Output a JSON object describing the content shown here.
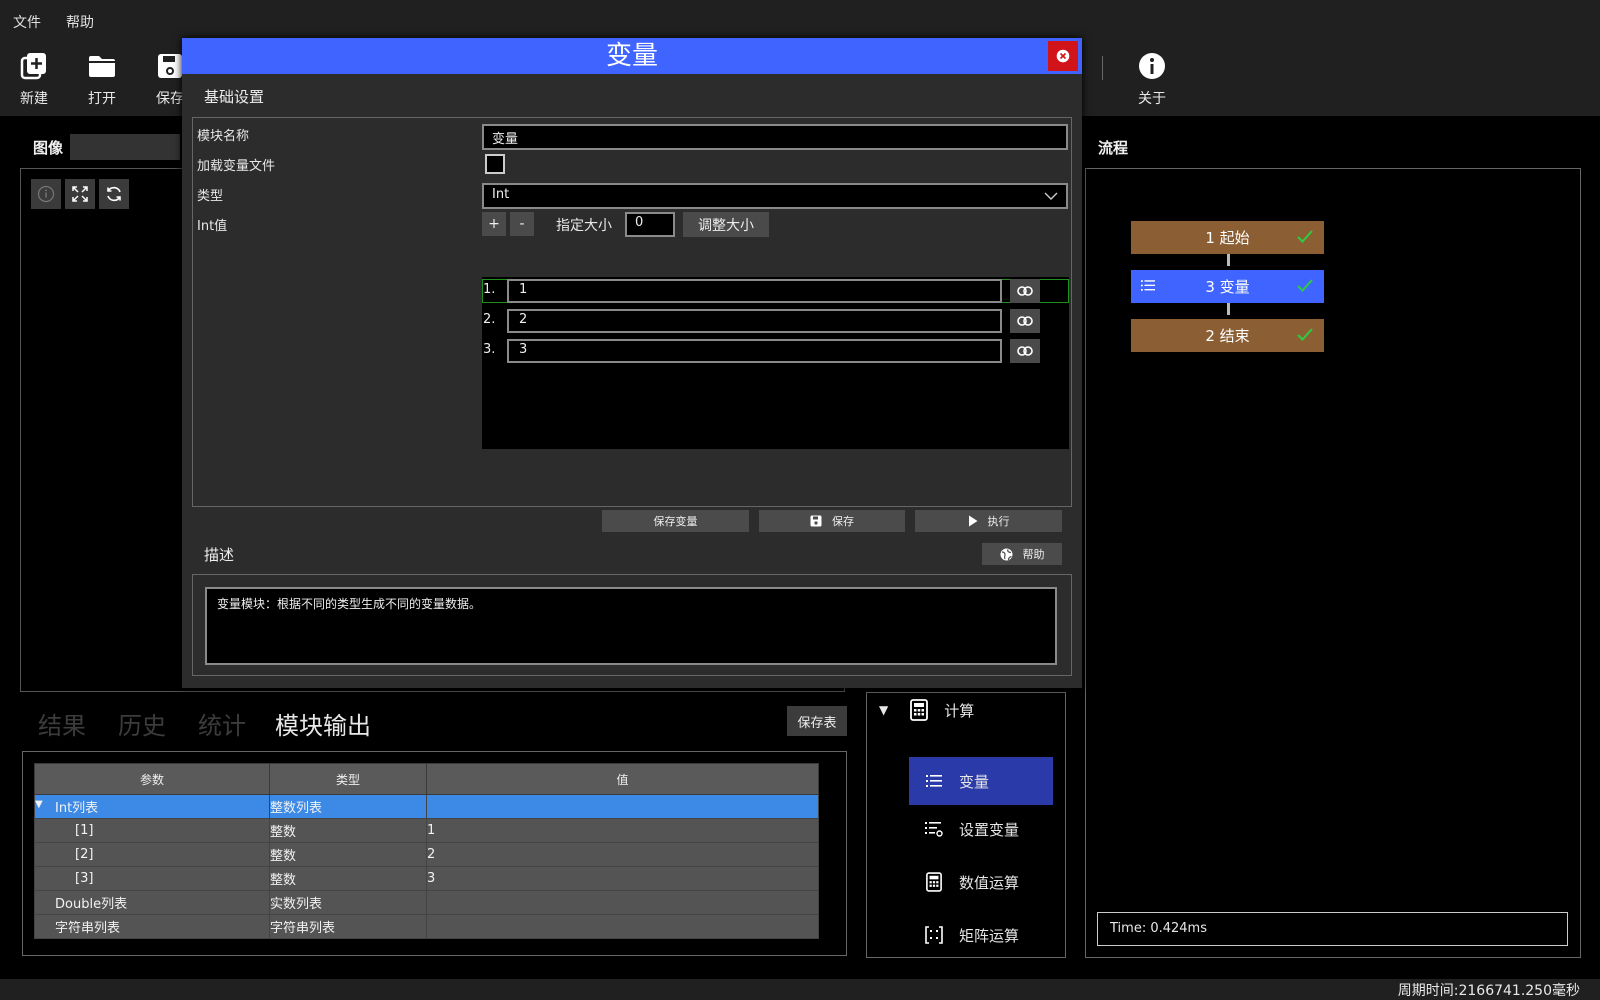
{
  "menu": [
    "文件",
    "帮助"
  ],
  "toolbar": {
    "new": "新建",
    "open": "打开",
    "save": "保存",
    "about": "关于"
  },
  "image_panel": {
    "title": "图像"
  },
  "flow_panel": {
    "title": "流程",
    "nodes": [
      {
        "label": "1 起始",
        "color": "#8b5e34",
        "status": "ok"
      },
      {
        "label": "3 变量",
        "color": "#3f64ff",
        "status": "ok"
      },
      {
        "label": "2 结束",
        "color": "#8b5e34",
        "status": "ok"
      }
    ],
    "time": "Time: 0.424ms"
  },
  "bottom_tabs": [
    "结果",
    "历史",
    "统计",
    "模块输出"
  ],
  "bottom_active_tab": "模块输出",
  "save_table_label": "保存表",
  "output_table": {
    "headers": [
      "参数",
      "类型",
      "值"
    ],
    "rows": [
      {
        "param": "Int列表",
        "type": "整数列表",
        "value": "",
        "expanded": true,
        "selected": true
      },
      {
        "param": "[1]",
        "type": "整数",
        "value": "1"
      },
      {
        "param": "[2]",
        "type": "整数",
        "value": "2"
      },
      {
        "param": "[3]",
        "type": "整数",
        "value": "3"
      },
      {
        "param": "Double列表",
        "type": "实数列表",
        "value": ""
      },
      {
        "param": "字符串列表",
        "type": "字符串列表",
        "value": ""
      }
    ]
  },
  "tool_tree": {
    "category": "计算",
    "items": [
      "变量",
      "设置变量",
      "数值运算",
      "矩阵运算"
    ],
    "selected": "变量"
  },
  "dialog": {
    "title": "变量",
    "section_basic": "基础设置",
    "labels": {
      "module_name": "模块名称",
      "load_file": "加载变量文件",
      "type": "类型",
      "int_value": "Int值"
    },
    "module_name_value": "变量",
    "load_file_checked": false,
    "type_value": "Int",
    "plus": "+",
    "minus": "-",
    "size_label": "指定大小",
    "size_value": "0",
    "resize_label": "调整大小",
    "list_items": [
      {
        "num": "1.",
        "value": "1"
      },
      {
        "num": "2.",
        "value": "2"
      },
      {
        "num": "3.",
        "value": "3"
      }
    ],
    "buttons": {
      "save_var": "保存变量",
      "save": "保存",
      "execute": "执行",
      "help": "帮助"
    },
    "section_desc": "描述",
    "description": "变量模块：根据不同的类型生成不同的变量数据。"
  },
  "status": {
    "cycle_time": "周期时间:2166741.250毫秒"
  },
  "colors": {
    "accent": "#3f64ff",
    "selection": "#3d8ae6",
    "node_brown": "#8b5e34",
    "close_red": "#d0141a"
  }
}
